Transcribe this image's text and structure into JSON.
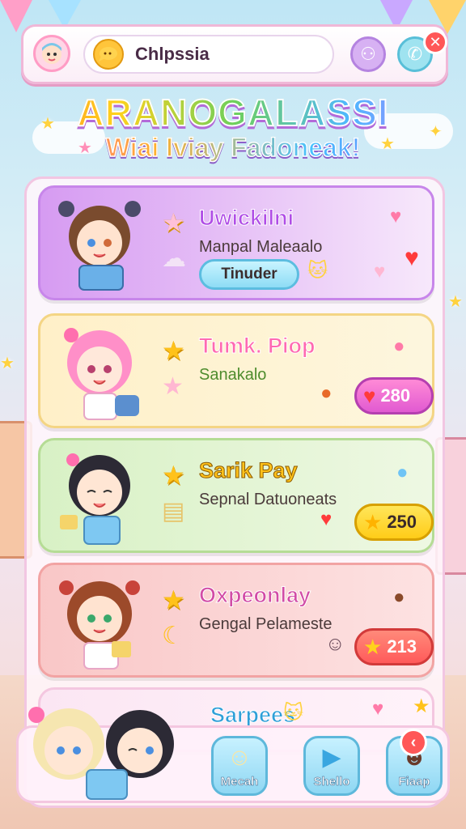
{
  "header": {
    "search_value": "Chlpssia",
    "avatar_icon": "avatar-face-icon",
    "friends_icon": "friends-icon",
    "call_icon": "phone-icon",
    "close_icon": "close-icon"
  },
  "titles": {
    "main": "ARANOGALASSI",
    "sub": "Wiai Iviay Fadoneak!"
  },
  "cards": [
    {
      "name": "Uwickilni",
      "desc": "Manpal Maleaalo",
      "button_label": "Tinuder",
      "accent": "#d69bf2"
    },
    {
      "name": "Tumk. Piop",
      "desc": "Sanakalo",
      "amount": "280",
      "amount_icon": "heart-icon",
      "accent": "#fff0c8"
    },
    {
      "name": "Sarik Pay",
      "desc": "Sepnal Datuoneats",
      "amount": "250",
      "amount_icon": "star-icon",
      "accent": "#d8f1c5"
    },
    {
      "name": "Oxpeonlay",
      "desc": "Gengal Pelameste",
      "amount": "213",
      "amount_icon": "star-icon",
      "accent": "#f9c7c7"
    },
    {
      "name": "Sarpees",
      "accent": "#fbe6f3"
    }
  ],
  "nav": {
    "items": [
      {
        "label": "Mecah",
        "icon": "character-icon"
      },
      {
        "label": "Shello",
        "icon": "play-icon"
      },
      {
        "label": "Fiaap",
        "icon": "friend-avatar-icon"
      }
    ],
    "back_icon": "back-arrow-icon"
  }
}
